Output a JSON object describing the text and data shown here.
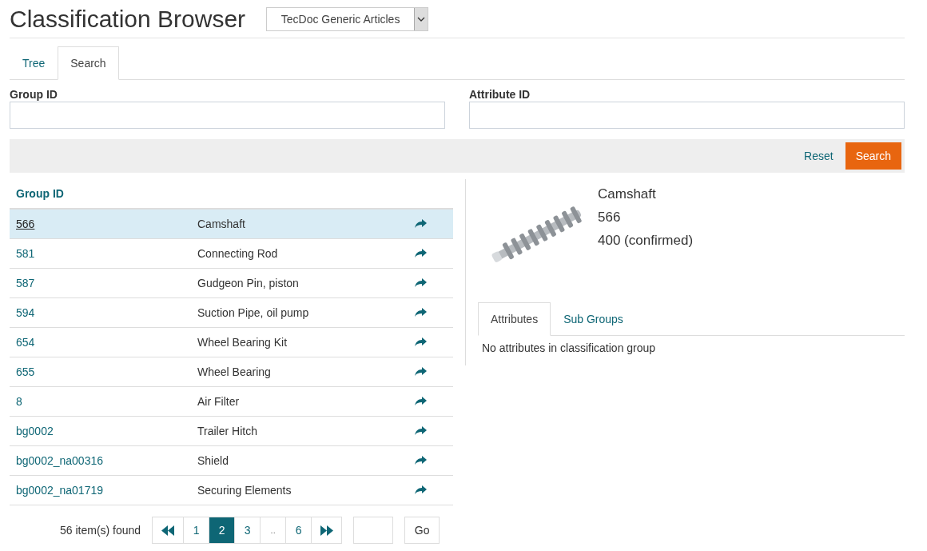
{
  "header": {
    "title": "Classification Browser",
    "dropdown": {
      "value": "TecDoc Generic Articles"
    }
  },
  "tabs": [
    {
      "label": "Tree",
      "selected": false
    },
    {
      "label": "Search",
      "selected": true
    }
  ],
  "fields": [
    {
      "label": "Group ID"
    },
    {
      "label": "Attribute ID"
    }
  ],
  "actions": {
    "reset": "Reset",
    "search": "Search"
  },
  "table": {
    "columns": [
      "Group ID"
    ],
    "rows": [
      {
        "id": "566",
        "name": "Camshaft",
        "selected": true
      },
      {
        "id": "581",
        "name": "Connecting Rod",
        "selected": false
      },
      {
        "id": "587",
        "name": "Gudgeon Pin, piston",
        "selected": false
      },
      {
        "id": "594",
        "name": "Suction Pipe, oil pump",
        "selected": false
      },
      {
        "id": "654",
        "name": "Wheel Bearing Kit",
        "selected": false
      },
      {
        "id": "655",
        "name": "Wheel Bearing",
        "selected": false
      },
      {
        "id": "8",
        "name": "Air Filter",
        "selected": false
      },
      {
        "id": "bg0002",
        "name": "Trailer Hitch",
        "selected": false
      },
      {
        "id": "bg0002_na00316",
        "name": "Shield",
        "selected": false
      },
      {
        "id": "bg0002_na01719",
        "name": "Securing Elements",
        "selected": false
      }
    ]
  },
  "pagination": {
    "summary": "56 item(s) found",
    "items": [
      {
        "kind": "first",
        "selected": false
      },
      {
        "kind": "page",
        "label": "1",
        "selected": false
      },
      {
        "kind": "page",
        "label": "2",
        "selected": true
      },
      {
        "kind": "page",
        "label": "3",
        "selected": false
      },
      {
        "kind": "ellipsis",
        "label": "..",
        "selected": false
      },
      {
        "kind": "page",
        "label": "6",
        "selected": false
      },
      {
        "kind": "last",
        "selected": false
      }
    ],
    "go": "Go"
  },
  "detail": {
    "name": "Camshaft",
    "id": "566",
    "status": "400 (confirmed)",
    "tabs": [
      {
        "label": "Attributes",
        "selected": true
      },
      {
        "label": "Sub Groups",
        "selected": false
      }
    ],
    "message": "No attributes in classification group"
  }
}
